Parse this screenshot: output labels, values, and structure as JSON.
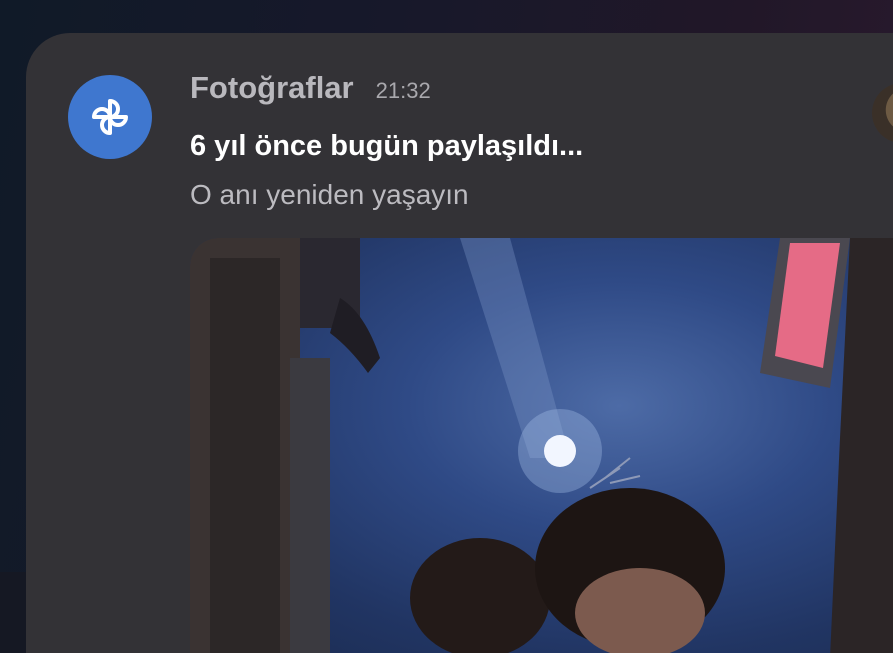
{
  "notification": {
    "app_name": "Fotoğraflar",
    "time": "21:32",
    "title": "6 yıl önce bugün paylaşıldı...",
    "subtitle": "O anı yeniden yaşayın",
    "app_icon": "pinwheel-icon",
    "accent_color": "#3f77cf",
    "card_color": "#333236"
  }
}
